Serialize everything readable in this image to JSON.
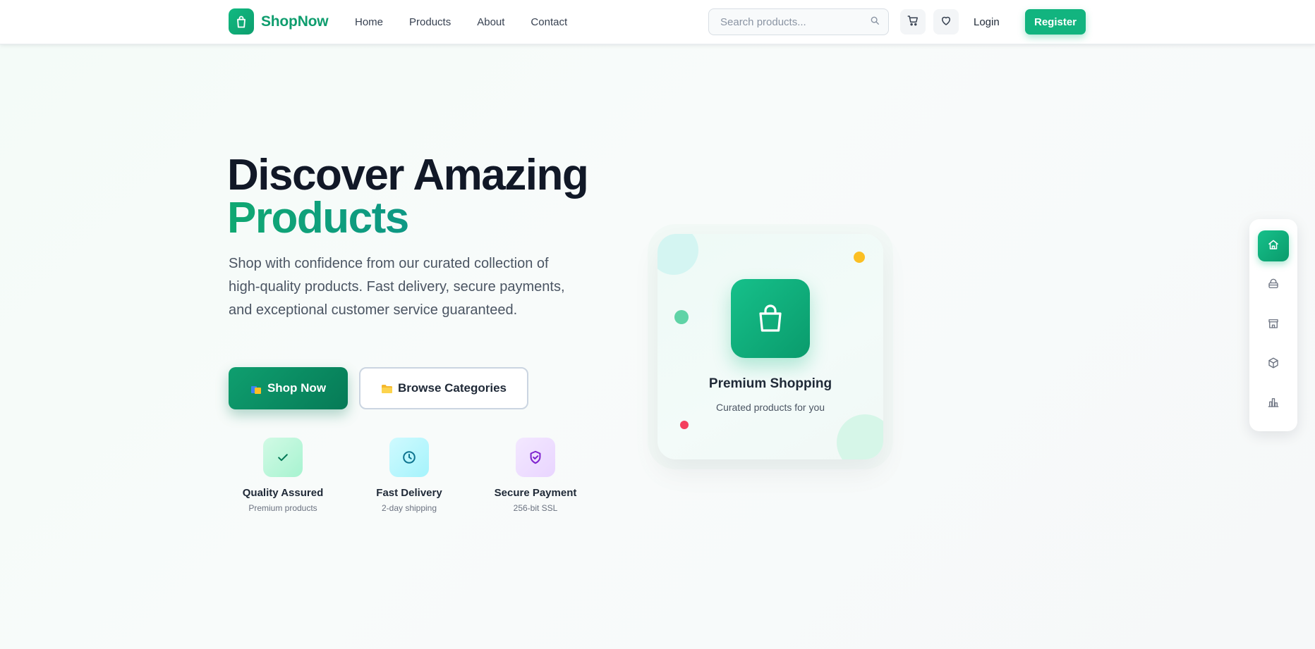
{
  "header": {
    "brand": "ShopNow",
    "nav": [
      {
        "label": "Home"
      },
      {
        "label": "Products"
      },
      {
        "label": "About"
      },
      {
        "label": "Contact"
      }
    ],
    "search": {
      "placeholder": "Search products...",
      "value": ""
    },
    "login_label": "Login",
    "register_label": "Register"
  },
  "hero": {
    "title_line1": "Discover Amazing",
    "title_line2": "Products",
    "description": "Shop with confidence from our curated collection of high-quality products. Fast delivery, secure payments, and exceptional customer service guaranteed.",
    "primary_button": "Shop Now",
    "secondary_button": "Browse Categories",
    "features": [
      {
        "title": "Quality Assured",
        "subtitle": "Premium products",
        "icon": "check-icon"
      },
      {
        "title": "Fast Delivery",
        "subtitle": "2-day shipping",
        "icon": "clock-icon"
      },
      {
        "title": "Secure Payment",
        "subtitle": "256-bit SSL",
        "icon": "shield-check-icon"
      }
    ]
  },
  "card": {
    "title": "Premium Shopping",
    "subtitle": "Curated products for you",
    "icon": "shopping-bag-icon"
  },
  "dock": {
    "items": [
      {
        "icon": "home-icon",
        "active": true
      },
      {
        "icon": "basket-icon",
        "active": false
      },
      {
        "icon": "store-icon",
        "active": false
      },
      {
        "icon": "box-icon",
        "active": false
      },
      {
        "icon": "chart-icon",
        "active": false
      }
    ]
  },
  "colors": {
    "brand": "#10b981",
    "brand_dark": "#067a56",
    "text_dark": "#111827",
    "text_muted": "#4b5563"
  }
}
